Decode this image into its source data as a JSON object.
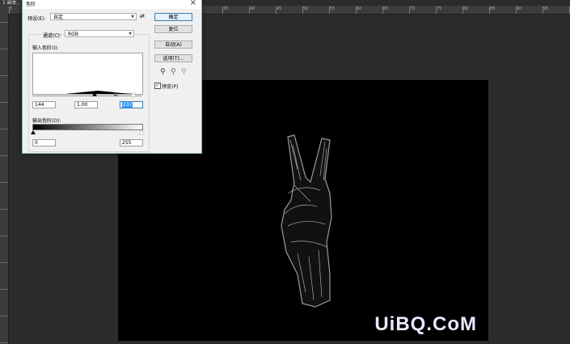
{
  "document_tab": "1 副本 ,  色阶",
  "ruler": {
    "top_ticks": [
      "5",
      "0",
      "5",
      "10",
      "15",
      "20",
      "25",
      "30",
      "35",
      "40",
      "45",
      "50",
      "55",
      "60",
      "65",
      "70",
      "75",
      "80",
      "85",
      "90",
      "95",
      "100"
    ]
  },
  "dialog": {
    "title": "色阶",
    "preset_label": "预设(E):",
    "preset_value": "自定",
    "channel_label": "通道(C):",
    "channel_value": "RGB",
    "input_levels_label": "输入色阶(I):",
    "input_black": "144",
    "input_gamma": "1.00",
    "input_white": "237",
    "output_levels_label": "输出色阶(O):",
    "output_black": "0",
    "output_white": "255",
    "buttons": {
      "ok": "确定",
      "reset": "复位",
      "auto": "自动(A)",
      "options": "选项(T)..."
    },
    "preview_label": "预览(P)",
    "preview_checked": true
  },
  "histogram_fill_color": "#000000",
  "watermark": "UiBQ.CoM"
}
